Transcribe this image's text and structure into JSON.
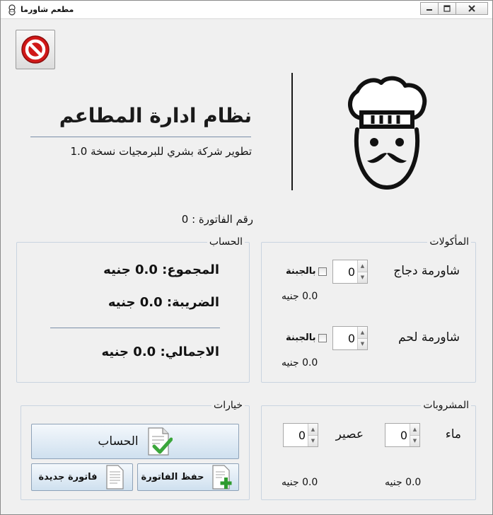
{
  "window": {
    "title": "مطعم شاورما",
    "minimize": "▭",
    "maximize": "▢",
    "close": "✕"
  },
  "header": {
    "title": "نظام ادارة المطاعم",
    "subtitle": "تطوير شركة بشري للبرمجيات نسخة 1.0"
  },
  "invoice": {
    "label": "رقم الفاتورة : 0"
  },
  "account": {
    "title": "الحساب",
    "subtotal": "المجموع: 0.0 جنيه",
    "tax": "الضريبة: 0.0 جنيه",
    "total": "الاجمالي: 0.0 جنيه"
  },
  "food": {
    "title": "المأكولات",
    "items": [
      {
        "label": "شاورمة دجاج",
        "cheese_label": "بالجبنة",
        "qty": "0",
        "price": "0.0 جنيه"
      },
      {
        "label": "شاورمة لحم",
        "cheese_label": "بالجبنة",
        "qty": "0",
        "price": "0.0 جنيه"
      }
    ]
  },
  "options": {
    "title": "خيارات",
    "calc_button": "الحساب",
    "save_button": "حفظ الفاتورة",
    "new_button": "فاتورة جديدة"
  },
  "drinks": {
    "title": "المشروبات",
    "items": [
      {
        "label": "ماء",
        "qty": "0",
        "price": "0.0 جنيه"
      },
      {
        "label": "عصير",
        "qty": "0",
        "price": "0.0 جنيه"
      }
    ]
  },
  "icons": {
    "exit": "no-entry-icon",
    "chef": "chef-icon",
    "calc": "document-check-icon",
    "save": "document-add-icon",
    "new": "document-icon"
  },
  "colors": {
    "exit_red": "#d01818",
    "check_green": "#3aa63a",
    "add_green": "#2f9b2f"
  }
}
